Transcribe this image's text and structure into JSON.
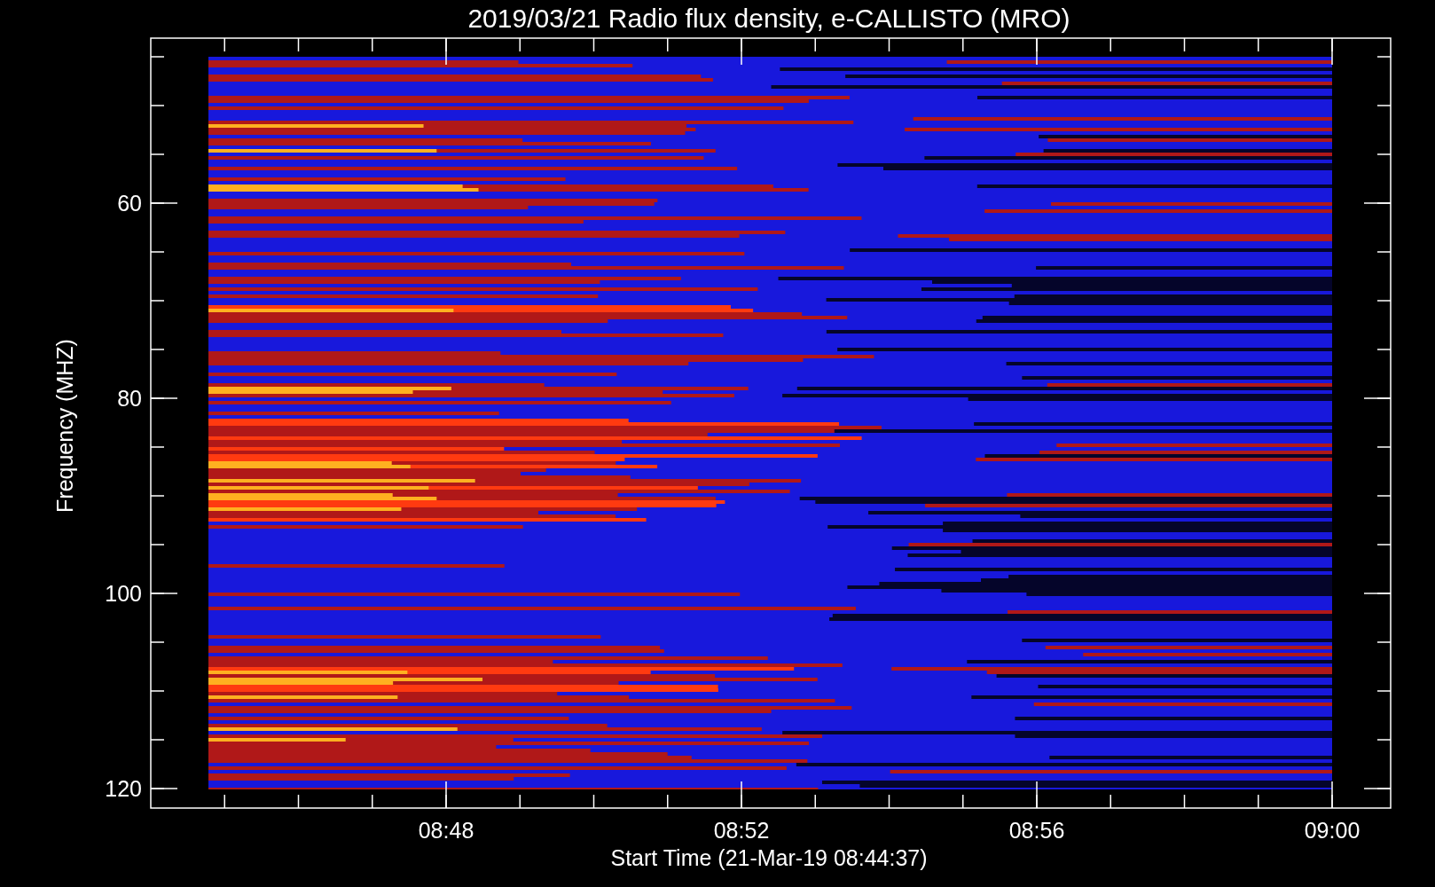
{
  "plot": {
    "title": "2019/03/21  Radio flux density, e-CALLISTO (MRO)"
  },
  "y_axis": {
    "label": "Frequency (MHZ)",
    "ticks": [
      "60",
      "80",
      "100",
      "120"
    ]
  },
  "x_axis": {
    "label": "Start Time (21-Mar-19 08:44:37)",
    "ticks": [
      "08:48",
      "08:52",
      "08:56",
      "09:00"
    ]
  }
}
